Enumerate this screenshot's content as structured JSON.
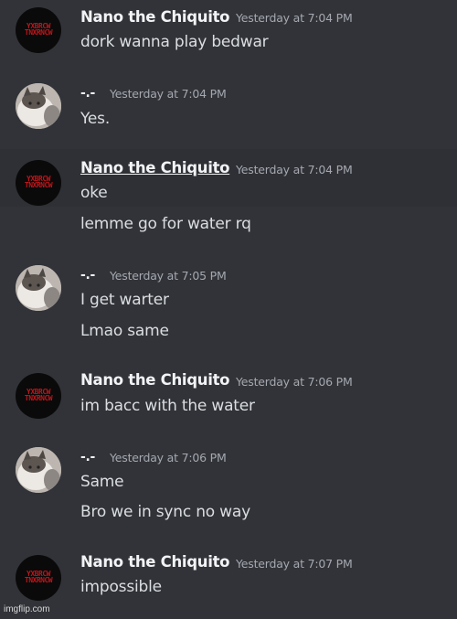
{
  "watermark": "imgflip.com",
  "avatar_logo_text": "YXBRCW TNXRNCW",
  "messages": [
    {
      "author": "Nano the Chiquito",
      "timestamp": "Yesterday at 7:04 PM",
      "lines": [
        "dork wanna play bedwar"
      ]
    },
    {
      "author": "-.-",
      "timestamp": "Yesterday at 7:04 PM",
      "lines": [
        "Yes."
      ]
    },
    {
      "author": "Nano the Chiquito",
      "timestamp": "Yesterday at 7:04 PM",
      "lines": [
        "oke",
        "lemme go for water rq"
      ]
    },
    {
      "author": "-.-",
      "timestamp": "Yesterday at 7:05 PM",
      "lines": [
        "I get warter",
        "Lmao same"
      ]
    },
    {
      "author": "Nano the Chiquito",
      "timestamp": "Yesterday at 7:06 PM",
      "lines": [
        "im bacc with the water"
      ]
    },
    {
      "author": "-.-",
      "timestamp": "Yesterday at 7:06 PM",
      "lines": [
        "Same",
        "Bro we in sync no way"
      ]
    },
    {
      "author": "Nano the Chiquito",
      "timestamp": "Yesterday at 7:07 PM",
      "lines": [
        "impossible"
      ]
    }
  ]
}
